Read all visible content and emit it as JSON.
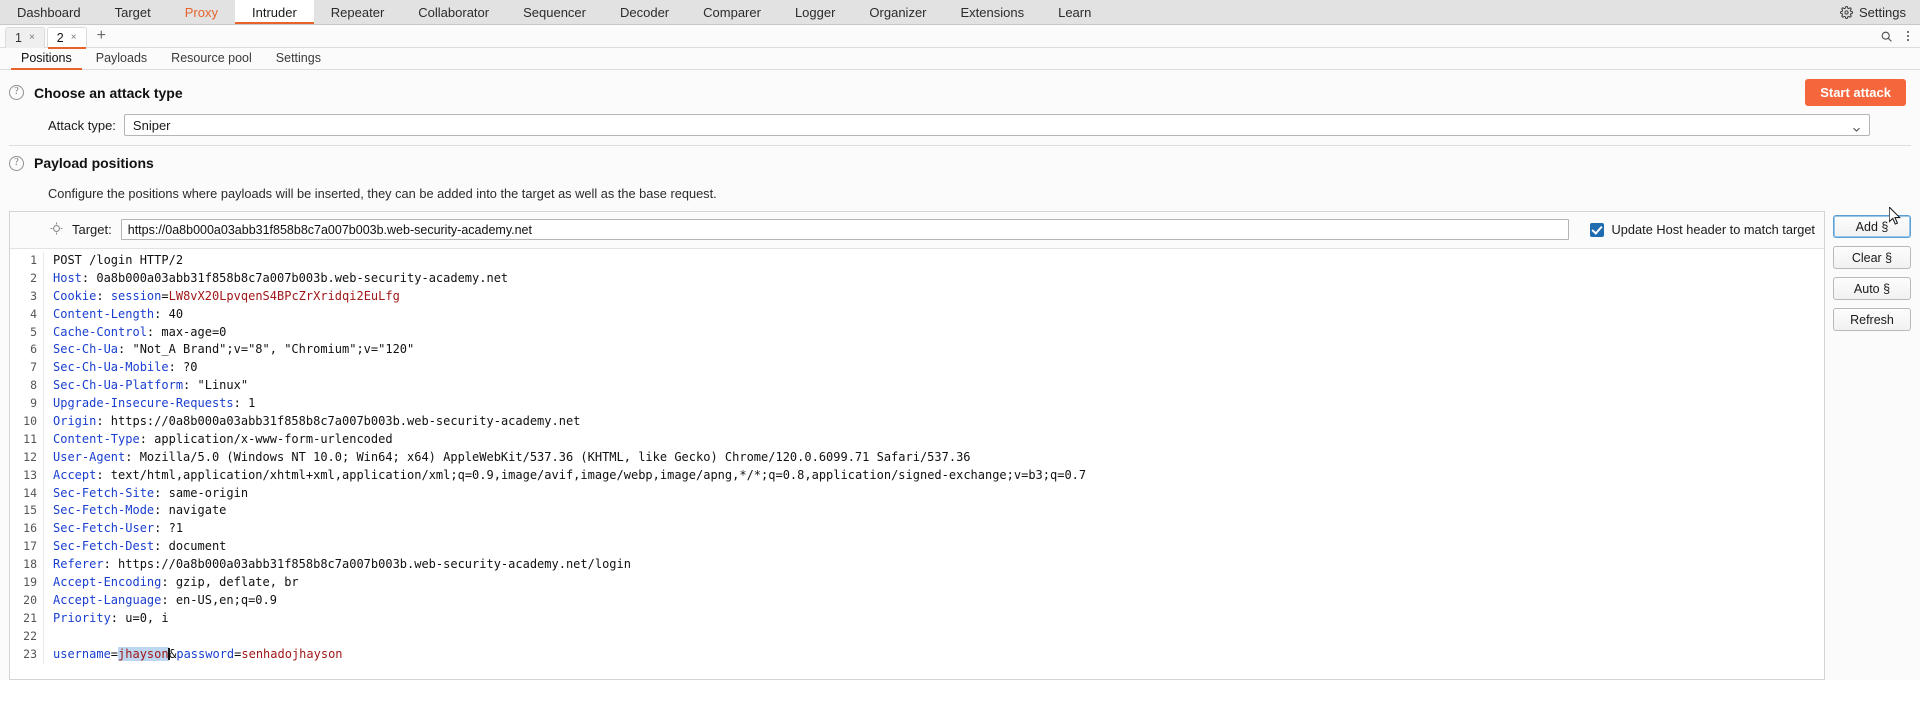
{
  "menubar": {
    "items": [
      {
        "label": "Dashboard",
        "state": "normal"
      },
      {
        "label": "Target",
        "state": "normal"
      },
      {
        "label": "Proxy",
        "state": "highlight"
      },
      {
        "label": "Intruder",
        "state": "active"
      },
      {
        "label": "Repeater",
        "state": "normal"
      },
      {
        "label": "Collaborator",
        "state": "normal"
      },
      {
        "label": "Sequencer",
        "state": "normal"
      },
      {
        "label": "Decoder",
        "state": "normal"
      },
      {
        "label": "Comparer",
        "state": "normal"
      },
      {
        "label": "Logger",
        "state": "normal"
      },
      {
        "label": "Organizer",
        "state": "normal"
      },
      {
        "label": "Extensions",
        "state": "normal"
      },
      {
        "label": "Learn",
        "state": "normal"
      }
    ],
    "settings_label": "Settings",
    "settings_icon": "gear-icon"
  },
  "attack_tabs": {
    "tabs": [
      {
        "label": "1",
        "close": "×",
        "active": false
      },
      {
        "label": "2",
        "close": "×",
        "active": true
      }
    ],
    "new_tab_label": "+",
    "search_icon": "search-icon",
    "overflow_icon": "kebab-menu-icon"
  },
  "subtabs": [
    {
      "label": "Positions",
      "active": true
    },
    {
      "label": "Payloads",
      "active": false
    },
    {
      "label": "Resource pool",
      "active": false
    },
    {
      "label": "Settings",
      "active": false
    }
  ],
  "attack_type_section": {
    "help_icon": "question-mark-icon",
    "title": "Choose an attack type",
    "start_button": "Start attack",
    "field_label": "Attack type:",
    "selected_value": "Sniper",
    "dropdown_icon": "chevron-down-icon"
  },
  "payload_positions_section": {
    "help_icon": "question-mark-icon",
    "title": "Payload positions",
    "description": "Configure the positions where payloads will be inserted, they can be added into the target as well as the base request."
  },
  "target_row": {
    "icon": "target-crosshair-icon",
    "label": "Target:",
    "value": "https://0a8b000a03abb31f858b8c7a007b003b.web-security-academy.net",
    "placeholder": "",
    "checkbox_checked": true,
    "checkbox_label": "Update Host header to match target"
  },
  "side_buttons": [
    {
      "label": "Add §",
      "focused": true
    },
    {
      "label": "Clear §",
      "focused": false
    },
    {
      "label": "Auto §",
      "focused": false
    },
    {
      "label": "Refresh",
      "focused": false
    }
  ],
  "request": {
    "lines": [
      {
        "n": "1",
        "plain": "POST /login HTTP/2"
      },
      {
        "n": "2",
        "key": "Host",
        "value": ": 0a8b000a03abb31f858b8c7a007b003b.web-security-academy.net"
      },
      {
        "n": "3",
        "key": "Cookie",
        "value": ": session=",
        "cookie_name": "session",
        "cookie_value": "LW8vX20LpvqenS4BPcZrXridqi2EuLfg"
      },
      {
        "n": "4",
        "key": "Content-Length",
        "value": ": 40"
      },
      {
        "n": "5",
        "key": "Cache-Control",
        "value": ": max-age=0"
      },
      {
        "n": "6",
        "key": "Sec-Ch-Ua",
        "value": ": \"Not_A Brand\";v=\"8\", \"Chromium\";v=\"120\""
      },
      {
        "n": "7",
        "key": "Sec-Ch-Ua-Mobile",
        "value": ": ?0"
      },
      {
        "n": "8",
        "key": "Sec-Ch-Ua-Platform",
        "value": ": \"Linux\""
      },
      {
        "n": "9",
        "key": "Upgrade-Insecure-Requests",
        "value": ": 1"
      },
      {
        "n": "10",
        "key": "Origin",
        "value": ": https://0a8b000a03abb31f858b8c7a007b003b.web-security-academy.net"
      },
      {
        "n": "11",
        "key": "Content-Type",
        "value": ": application/x-www-form-urlencoded"
      },
      {
        "n": "12",
        "key": "User-Agent",
        "value": ": Mozilla/5.0 (Windows NT 10.0; Win64; x64) AppleWebKit/537.36 (KHTML, like Gecko) Chrome/120.0.6099.71 Safari/537.36"
      },
      {
        "n": "13",
        "key": "Accept",
        "value": ": text/html,application/xhtml+xml,application/xml;q=0.9,image/avif,image/webp,image/apng,*/*;q=0.8,application/signed-exchange;v=b3;q=0.7"
      },
      {
        "n": "14",
        "key": "Sec-Fetch-Site",
        "value": ": same-origin"
      },
      {
        "n": "15",
        "key": "Sec-Fetch-Mode",
        "value": ": navigate"
      },
      {
        "n": "16",
        "key": "Sec-Fetch-User",
        "value": ": ?1"
      },
      {
        "n": "17",
        "key": "Sec-Fetch-Dest",
        "value": ": document"
      },
      {
        "n": "18",
        "key": "Referer",
        "value": ": https://0a8b000a03abb31f858b8c7a007b003b.web-security-academy.net/login"
      },
      {
        "n": "19",
        "key": "Accept-Encoding",
        "value": ": gzip, deflate, br"
      },
      {
        "n": "20",
        "key": "Accept-Language",
        "value": ": en-US,en;q=0.9"
      },
      {
        "n": "21",
        "key": "Priority",
        "value": ": u=0, i"
      },
      {
        "n": "22",
        "plain": ""
      },
      {
        "n": "23",
        "body": true
      }
    ],
    "body": {
      "param1_name": "username",
      "param1_eq": "=",
      "param1_value_selected": "jhayson",
      "separator": "&",
      "param2_name": "password",
      "param2_eq": "=",
      "param2_value": "senhadojhayson"
    }
  }
}
